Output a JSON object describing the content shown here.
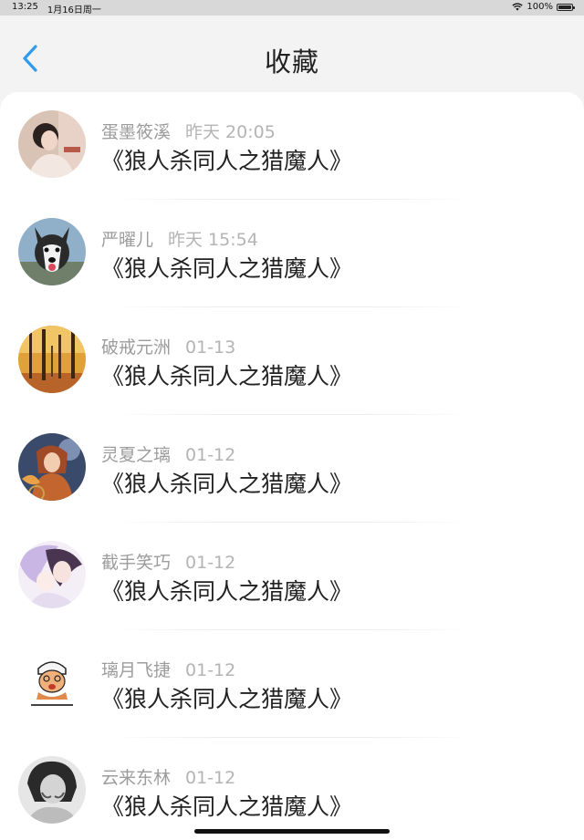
{
  "status_bar": {
    "time": "13:25",
    "date": "1月16日周一",
    "battery": "100%",
    "battery_level": 1.0,
    "wifi_icon": "wifi-icon"
  },
  "nav": {
    "title": "收藏",
    "back_icon": "chevron-left-icon",
    "accent_color": "#2f9bf0"
  },
  "items": [
    {
      "author": "蛋墨筱溪",
      "time": "昨天 20:05",
      "title": "《狼人杀同人之猎魔人》",
      "avatar": "girl-portrait"
    },
    {
      "author": "严曜儿",
      "time": "昨天 15:54",
      "title": "《狼人杀同人之猎魔人》",
      "avatar": "husky-dog"
    },
    {
      "author": "破戒元洲",
      "time": "01-13",
      "title": "《狼人杀同人之猎魔人》",
      "avatar": "autumn-forest"
    },
    {
      "author": "灵夏之璃",
      "time": "01-12",
      "title": "《狼人杀同人之猎魔人》",
      "avatar": "fantasy-girl"
    },
    {
      "author": "截手笑巧",
      "time": "01-12",
      "title": "《狼人杀同人之猎魔人》",
      "avatar": "anime-couple"
    },
    {
      "author": "璃月飞捷",
      "time": "01-12",
      "title": "《狼人杀同人之猎魔人》",
      "avatar": "cartoon-man"
    },
    {
      "author": "云来东林",
      "time": "01-12",
      "title": "《狼人杀同人之猎魔人》",
      "avatar": "bw-portrait"
    }
  ]
}
